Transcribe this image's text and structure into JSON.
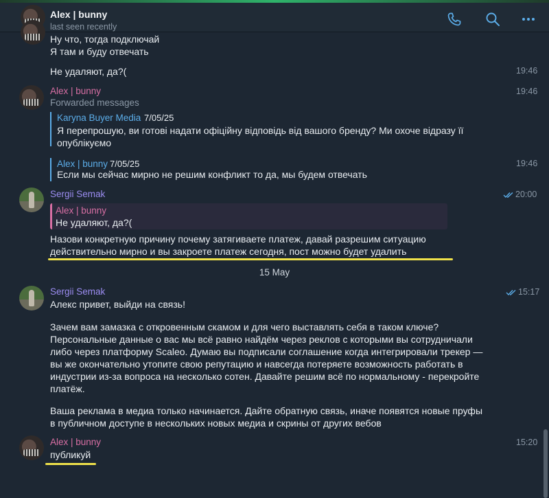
{
  "header": {
    "name": "Alex | bunny",
    "status": "last seen recently"
  },
  "messages": {
    "m1_lines": [
      "Ну что, тогда подключай",
      "Я там и буду отвечать"
    ],
    "m2_text": "Не удаляют, да?(",
    "m2_time": "19:46",
    "fwd": {
      "sender": "Alex | bunny",
      "time": "19:46",
      "label": "Forwarded messages",
      "q1_author": "Karyna Buyer Media",
      "q1_date": "7/05/25",
      "q1_lines": [
        "Я перепрошую, ви готові надати офіційну відповідь від вашого бренду? Ми охоче відразу її",
        "опублікуємо"
      ],
      "q2_author": "Alex | bunny",
      "q2_date": "7/05/25",
      "q2_time": "19:46",
      "q2_text": "Если мы сейчас мирно не решим конфликт то да, мы будем отвечать"
    },
    "s1": {
      "sender": "Sergii Semak",
      "time": "20:00",
      "reply_author": "Alex | bunny",
      "reply_text": "Не удаляют, да?(",
      "lines": [
        "Назови конкретную причину почему затягиваете платеж, давай разрешим ситуацию",
        "действительно мирно и вы закроете платеж сегодня, пост можно будет удалить"
      ]
    },
    "date_separator": "15 May",
    "s2": {
      "sender": "Sergii Semak",
      "time": "15:17",
      "lines": [
        "Алекс привет, выйди на связь!",
        "",
        "Зачем вам замазка с откровенным скамом и для чего выставлять себя в таком ключе?",
        "Персональные данные о вас мы всё равно найдём через реклов с которыми вы сотрудничали",
        "либо через платформу Scaleo. Думаю вы подписали соглашение когда интегрировали трекер —",
        "вы же окончательно утопите свою репутацию и навсегда потеряете возможность работать в",
        "индустрии из-за вопроса на несколько сотен. Давайте решим всё по нормальному - перекройте",
        "платёж.",
        "",
        "Ваша реклама в медиа только начинается. Дайте обратную связь, иначе появятся новые пруфы",
        "в публичном доступе в нескольких новых медиа  и скрины от других вебов"
      ]
    },
    "a_last": {
      "sender": "Alex | bunny",
      "time": "15:20",
      "text": "публикуй"
    }
  },
  "colors": {
    "background": "#1d2733",
    "alex_name": "#d86fa4",
    "sergii_name": "#9b8cf0",
    "link_blue": "#5caeea",
    "highlight_underline": "#f0e24a"
  },
  "icons": [
    "phone-icon",
    "search-icon",
    "more-icon",
    "double-check-icon"
  ]
}
